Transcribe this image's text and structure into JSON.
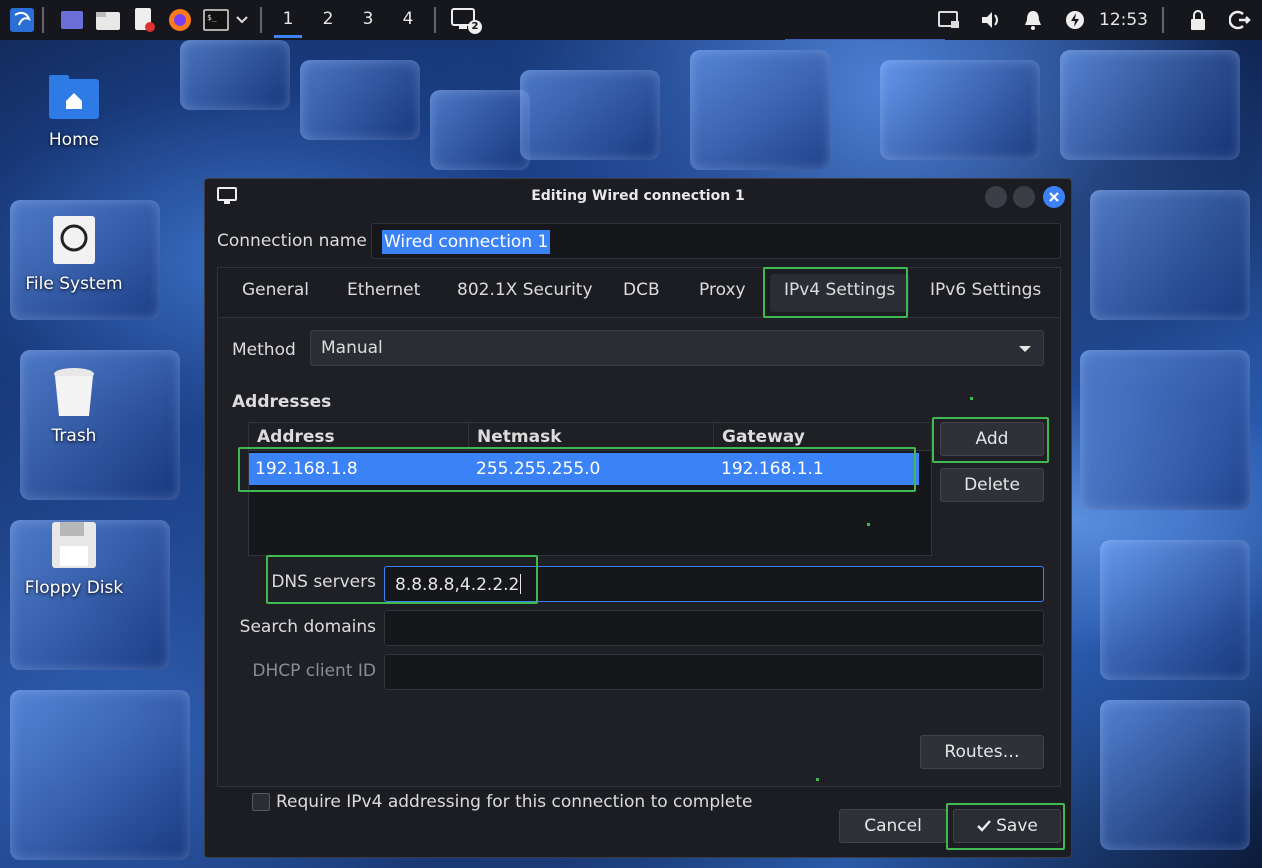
{
  "desktop": {
    "icons": [
      {
        "label": "Home"
      },
      {
        "label": "File System"
      },
      {
        "label": "Trash"
      },
      {
        "label": "Floppy Disk"
      }
    ]
  },
  "panel": {
    "workspaces": [
      "1",
      "2",
      "3",
      "4"
    ],
    "active_workspace": "1",
    "window_badge": "2",
    "clock": "12:53"
  },
  "dialog": {
    "title": "Editing Wired connection 1",
    "connection_name_label": "Connection name",
    "connection_name_value": "Wired connection 1",
    "tabs": [
      "General",
      "Ethernet",
      "802.1X Security",
      "DCB",
      "Proxy",
      "IPv4 Settings",
      "IPv6 Settings"
    ],
    "active_tab": "IPv4 Settings",
    "method_label": "Method",
    "method_value": "Manual",
    "addresses_title": "Addresses",
    "columns": [
      "Address",
      "Netmask",
      "Gateway"
    ],
    "rows": [
      {
        "address": "192.168.1.8",
        "netmask": "255.255.255.0",
        "gateway": "192.168.1.1"
      }
    ],
    "add_label": "Add",
    "delete_label": "Delete",
    "dns_label": "DNS servers",
    "dns_value": "8.8.8.8,4.2.2.2",
    "search_domains_label": "Search domains",
    "search_domains_value": "",
    "dhcp_client_id_label": "DHCP client ID",
    "dhcp_client_id_value": "",
    "require_ipv4_label": "Require IPv4 addressing for this connection to complete",
    "require_ipv4_checked": false,
    "routes_label": "Routes…",
    "cancel_label": "Cancel",
    "save_label": "Save"
  },
  "colors": {
    "accent": "#3b82f6",
    "highlight": "#3fb950",
    "dialog_bg": "#1b1d22"
  }
}
